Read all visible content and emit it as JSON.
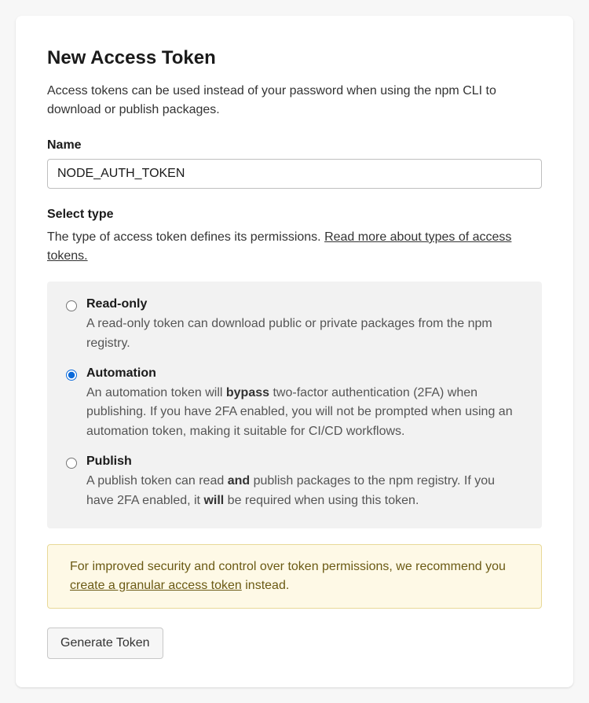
{
  "title": "New Access Token",
  "description": "Access tokens can be used instead of your password when using the npm CLI to download or publish packages.",
  "name_field": {
    "label": "Name",
    "value": "NODE_AUTH_TOKEN"
  },
  "type_section": {
    "label": "Select type",
    "description_prefix": "The type of access token defines its permissions. ",
    "link_text": "Read more about types of access tokens.",
    "options": [
      {
        "title": "Read-only",
        "description": "A read-only token can download public or private packages from the npm registry.",
        "selected": false
      },
      {
        "title": "Automation",
        "description_parts": {
          "p1": "An automation token will ",
          "b1": "bypass",
          "p2": " two-factor authentication (2FA) when publishing. If you have 2FA enabled, you will not be prompted when using an automation token, making it suitable for CI/CD workflows."
        },
        "selected": true
      },
      {
        "title": "Publish",
        "description_parts": {
          "p1": "A publish token can read ",
          "b1": "and",
          "p2": " publish packages to the npm registry. If you have 2FA enabled, it ",
          "b2": "will",
          "p3": " be required when using this token."
        },
        "selected": false
      }
    ]
  },
  "notice": {
    "prefix": "For improved security and control over token permissions, we recommend you ",
    "link_text": "create a granular access token",
    "suffix": " instead."
  },
  "generate_button": "Generate Token"
}
